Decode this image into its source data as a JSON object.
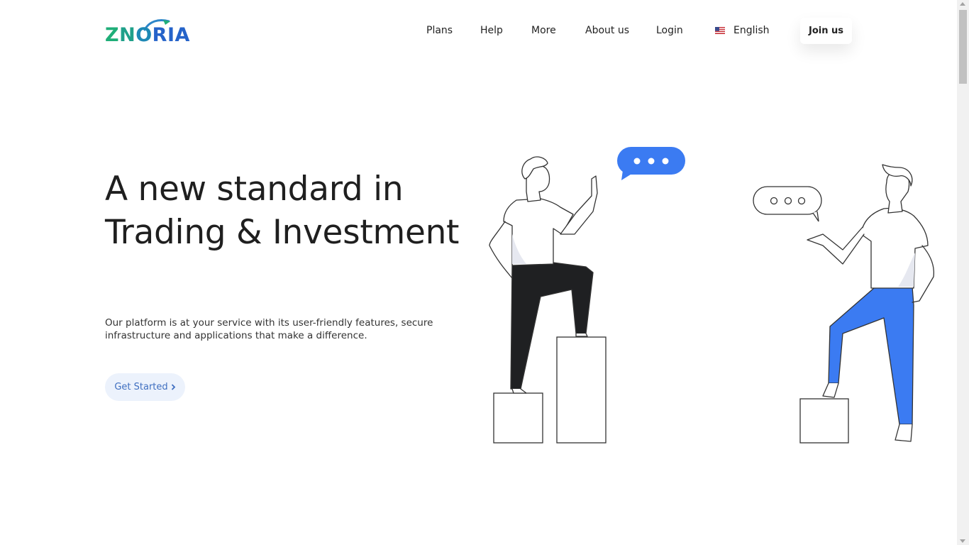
{
  "brand": {
    "logo_text": "ZNORIA",
    "colors": {
      "green": "#1fae78",
      "blue": "#2563c9"
    }
  },
  "nav": {
    "items": [
      {
        "label": "Plans"
      },
      {
        "label": "Help"
      },
      {
        "label": "More"
      },
      {
        "label": "About us"
      },
      {
        "label": "Login"
      }
    ],
    "language": {
      "label": "English",
      "flag": "us-flag-icon"
    },
    "join_label": "Join us"
  },
  "hero": {
    "title": "A new standard in Trading & Investment",
    "subtitle": "Our platform is at your service with its user-friendly features, secure infrastructure and applications that make a difference.",
    "cta_label": "Get Started",
    "cta_icon": "chevron-right-icon",
    "accent_color": "#3b7bf2"
  }
}
